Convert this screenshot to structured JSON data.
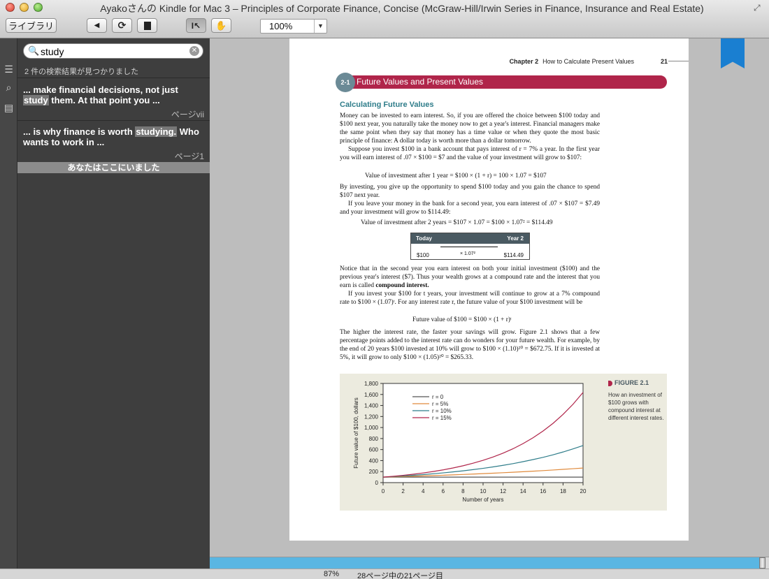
{
  "window": {
    "title": "Ayakoさんの Kindle for Mac 3 – Principles of Corporate Finance, Concise (McGraw-Hill/Irwin Series in Finance, Insurance and Real Estate)"
  },
  "toolbar": {
    "library_label": "ライブラリ",
    "back_icon": "back-arrow-icon",
    "sync_icon": "sync-icon",
    "bookmark_icon": "bookmark-icon",
    "select_icon": "text-select-icon",
    "hand_icon": "hand-icon",
    "zoom_value": "100%"
  },
  "search": {
    "query": "study",
    "result_count": "2 件の検索結果が見つかりました",
    "results": [
      {
        "before": "... make financial decisions, not just ",
        "match": "study",
        "after": " them. At that point you  ...",
        "page": "ページvii"
      },
      {
        "before": "... is why finance is worth ",
        "match": "studying.",
        "after": " Who wants to work in  ...",
        "page": "ページ1"
      }
    ],
    "you_were_here": "あなたはここにいました"
  },
  "book": {
    "chapter_label": "Chapter 2",
    "chapter_title": "How to Calculate Present Values",
    "page_number": "21",
    "section_number": "2-1",
    "section_title": "Future Values and Present Values",
    "subhead": "Calculating Future Values",
    "para1": "Money can be invested to earn interest. So, if you are offered the choice between $100 today and $100 next year, you naturally take the money now to get a year's interest. Financial managers make the same point when they say that money has a time value or when they quote the most basic principle of finance: A dollar today is worth more than a dollar tomorrow.",
    "para2": "Suppose you invest $100 in a bank account that pays interest of r = 7% a year. In the first year you will earn interest of .07 × $100 = $7 and the value of your investment will grow to $107:",
    "eq1": "Value of investment after 1 year = $100 × (1 + r) = 100 × 1.07 = $107",
    "para3": "By investing, you give up the opportunity to spend $100 today and you gain the chance to spend $107 next year.",
    "para4": "If you leave your money in the bank for a second year, you earn interest of .07 × $107 = $7.49 and your investment will grow to $114.49:",
    "eq2": "Value of investment after 2 years = $107 × 1.07 = $100 × 1.07² = $114.49",
    "timeline": {
      "left_head": "Today",
      "right_head": "Year 2",
      "left_val": "$100",
      "mid_val": "× 1.07²",
      "right_val": "$114.49"
    },
    "para5_a": "Notice that in the second year you earn interest on both your initial investment ($100) and the previous year's interest ($7). Thus your wealth grows at a compound rate and the interest that you earn is called ",
    "para5_bold": "compound interest.",
    "para6": "If you invest your $100 for t years, your investment will continue to grow at a 7% compound rate to $100 × (1.07)ᵗ. For any interest rate r, the future value of your $100 investment will be",
    "eq3": "Future value of $100 = $100 × (1 + r)ᵗ",
    "para7": "The higher the interest rate, the faster your savings will grow. Figure 2.1 shows that a few percentage points added to the interest rate can do wonders for your future wealth. For example, by the end of 20 years $100 invested at 10% will grow to $100 × (1.10)²⁰ = $672.75. If it is invested at 5%, it will grow to only $100 × (1.05)²⁰ = $265.33.",
    "figure_label": "FIGURE 2.1",
    "figure_caption": "How an investment of $100 grows with compound interest at different interest rates."
  },
  "chart_data": {
    "type": "line",
    "title": "",
    "xlabel": "Number of years",
    "ylabel": "Future value of $100, dollars",
    "xlim": [
      0,
      20
    ],
    "ylim": [
      0,
      1800
    ],
    "x_ticks": [
      0,
      2,
      4,
      6,
      8,
      10,
      12,
      14,
      16,
      18,
      20
    ],
    "y_ticks": [
      0,
      200,
      400,
      600,
      800,
      1000,
      1200,
      1400,
      1600,
      1800
    ],
    "y_tick_labels": [
      "0",
      "200",
      "400",
      "600",
      "800",
      "1,000",
      "1,200",
      "1,400",
      "1,600",
      "1,800"
    ],
    "legend": "top-left",
    "x": [
      0,
      1,
      2,
      3,
      4,
      5,
      6,
      7,
      8,
      9,
      10,
      11,
      12,
      13,
      14,
      15,
      16,
      17,
      18,
      19,
      20
    ],
    "series": [
      {
        "name": "r = 0",
        "color": "#555555",
        "values": [
          100,
          100,
          100,
          100,
          100,
          100,
          100,
          100,
          100,
          100,
          100,
          100,
          100,
          100,
          100,
          100,
          100,
          100,
          100,
          100,
          100
        ]
      },
      {
        "name": "r = 5%",
        "color": "#e08a3c",
        "values": [
          100,
          105,
          110,
          116,
          122,
          128,
          134,
          141,
          148,
          155,
          163,
          171,
          180,
          189,
          198,
          208,
          218,
          229,
          241,
          253,
          265
        ]
      },
      {
        "name": "r = 10%",
        "color": "#2f7d8a",
        "values": [
          100,
          110,
          121,
          133,
          146,
          161,
          177,
          195,
          214,
          236,
          259,
          285,
          314,
          345,
          380,
          418,
          459,
          505,
          556,
          612,
          673
        ]
      },
      {
        "name": "r = 15%",
        "color": "#b0254a",
        "values": [
          100,
          115,
          132,
          152,
          175,
          201,
          231,
          266,
          306,
          352,
          405,
          465,
          535,
          615,
          708,
          814,
          936,
          1076,
          1238,
          1423,
          1637
        ]
      }
    ]
  },
  "status": {
    "progress_percent": 87,
    "percent_label": "87%",
    "location_label": "28ページ中の21ページ目"
  },
  "colors": {
    "progress": "#5ab6e2",
    "section_bar": "#b0254a",
    "subhead": "#2f7d8a",
    "bookmark": "#1a7fd1"
  }
}
